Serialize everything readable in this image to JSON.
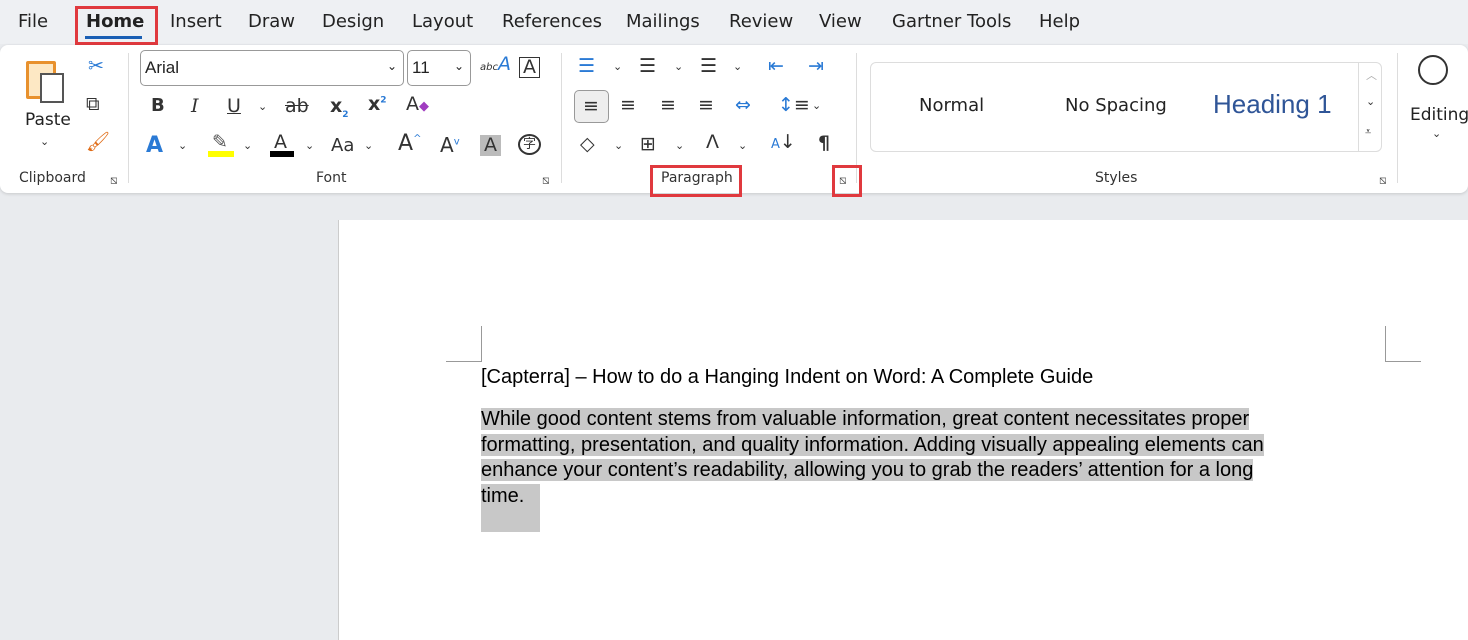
{
  "tabs": [
    "File",
    "Home",
    "Insert",
    "Draw",
    "Design",
    "Layout",
    "References",
    "Mailings",
    "Review",
    "View",
    "Gartner Tools",
    "Help"
  ],
  "active_tab": "Home",
  "clipboard": {
    "paste": "Paste",
    "label": "Clipboard"
  },
  "font": {
    "name": "Arial",
    "size": "11",
    "label": "Font",
    "highlight_color": "#ffff00",
    "font_color": "#000000"
  },
  "paragraph": {
    "label": "Paragraph"
  },
  "styles": {
    "items": [
      "Normal",
      "No Spacing",
      "Heading 1"
    ],
    "label": "Styles"
  },
  "editing": {
    "label": "Editing"
  },
  "document": {
    "title": "[Capterra] – How to do a Hanging Indent on Word: A Complete Guide",
    "lines": [
      "While good content stems from valuable information, great content necessitates proper",
      "formatting, presentation, and quality information. Adding visually appealing elements can",
      "enhance your content’s readability, allowing you to grab the readers’ attention for a long",
      "time."
    ]
  },
  "highlight_color": "#e0393e"
}
